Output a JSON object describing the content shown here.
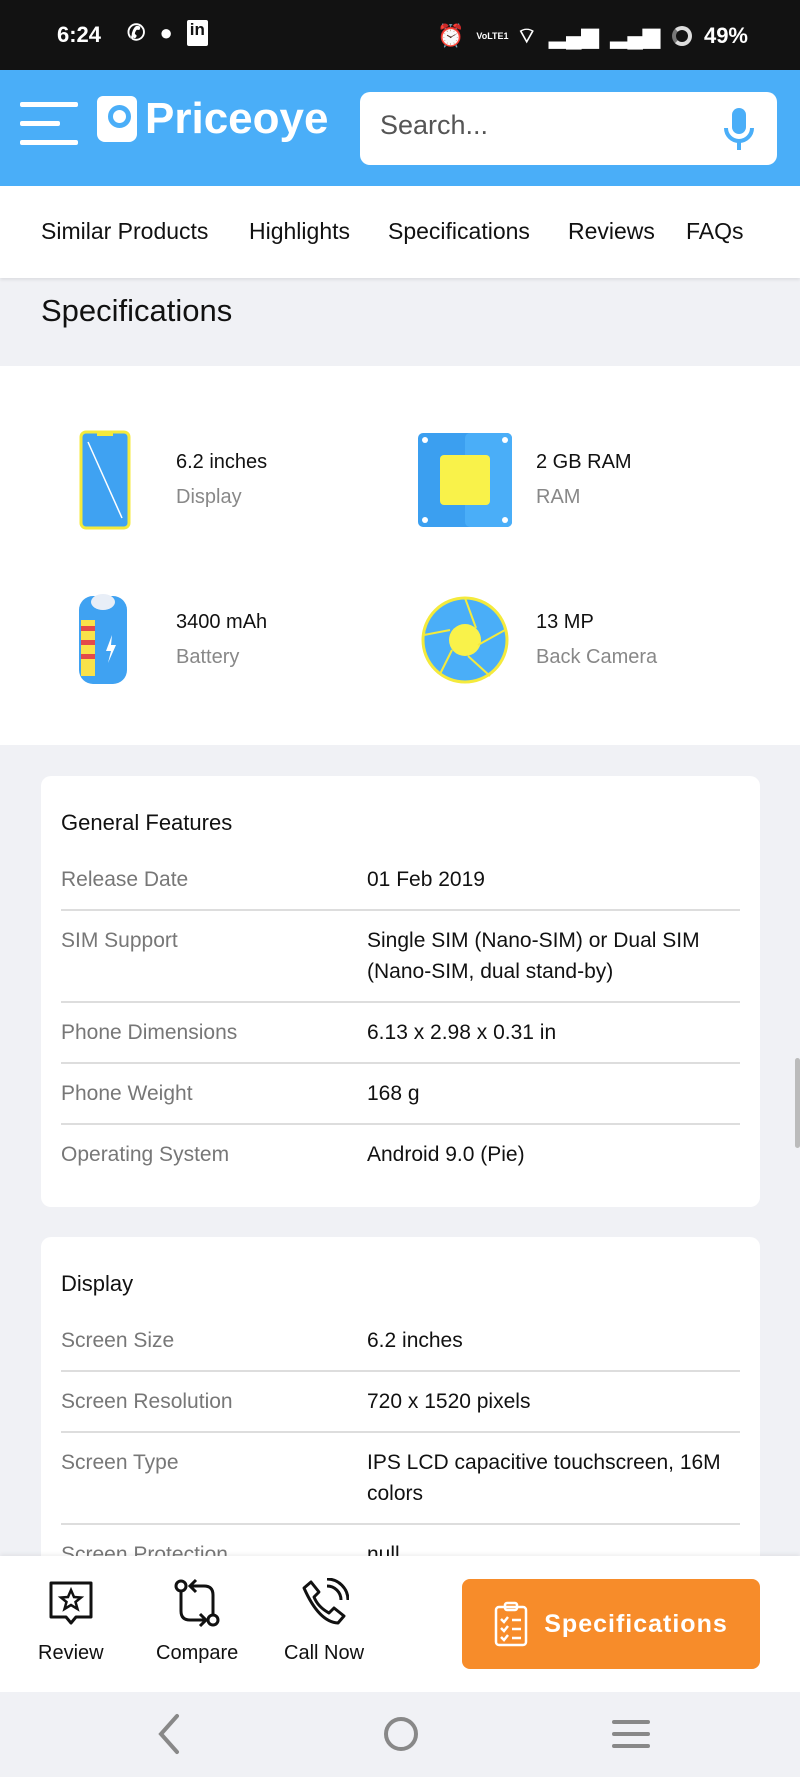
{
  "status_bar": {
    "time": "6:24",
    "battery": "49%",
    "network": "VoLTE1"
  },
  "header": {
    "logo": "Priceoye",
    "search_placeholder": "Search...",
    "brand_color": "#4aaef8"
  },
  "tabs": [
    "Similar Products",
    "Highlights",
    "Specifications",
    "Reviews",
    "FAQs"
  ],
  "section_title": "Specifications",
  "highlights": [
    {
      "value": "6.2 inches",
      "label": "Display",
      "icon": "phone-display-icon"
    },
    {
      "value": "2 GB RAM",
      "label": "RAM",
      "icon": "chip-icon"
    },
    {
      "value": "3400 mAh",
      "label": "Battery",
      "icon": "battery-icon"
    },
    {
      "value": "13 MP",
      "label": "Back Camera",
      "icon": "camera-aperture-icon"
    }
  ],
  "cards": [
    {
      "title": "General Features",
      "rows": [
        {
          "k": "Release Date",
          "v": "01 Feb 2019"
        },
        {
          "k": "SIM Support",
          "v": "Single SIM (Nano-SIM) or Dual SIM (Nano-SIM, dual stand-by)"
        },
        {
          "k": "Phone Dimensions",
          "v": "6.13 x 2.98 x 0.31 in"
        },
        {
          "k": "Phone Weight",
          "v": "168 g"
        },
        {
          "k": "Operating System",
          "v": "Android 9.0 (Pie)"
        }
      ]
    },
    {
      "title": "Display",
      "rows": [
        {
          "k": "Screen Size",
          "v": "6.2 inches"
        },
        {
          "k": "Screen Resolution",
          "v": "720 x 1520 pixels"
        },
        {
          "k": "Screen Type",
          "v": "IPS LCD capacitive touchscreen, 16M colors"
        },
        {
          "k": "Screen Protection",
          "v": "null"
        }
      ]
    }
  ],
  "bottom_bar": {
    "review": "Review",
    "compare": "Compare",
    "call": "Call Now",
    "specs": "Specifications",
    "specs_color": "#f78c2a"
  }
}
